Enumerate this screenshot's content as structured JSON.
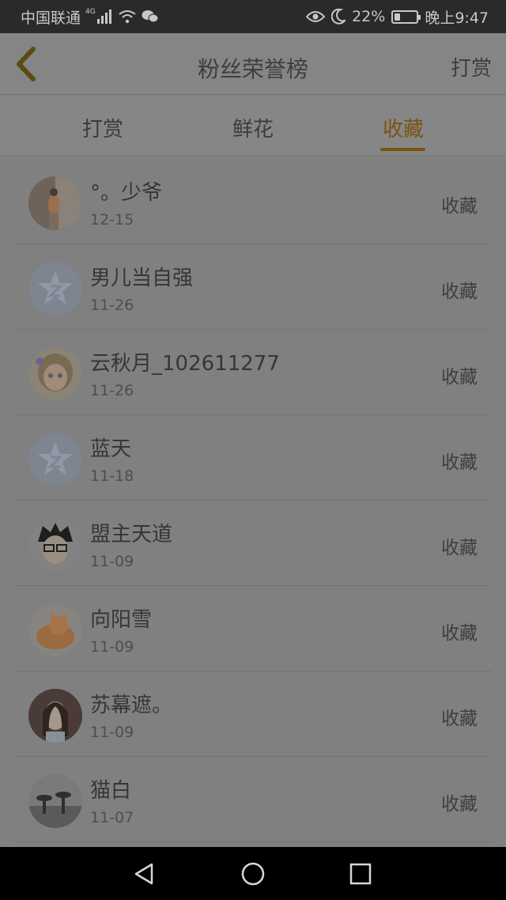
{
  "status_bar": {
    "carrier": "中国联通",
    "network": "4G",
    "battery": "22%",
    "battery_level": 0.22,
    "time": "晚上9:47",
    "icons": [
      "signal-icon",
      "wifi-icon",
      "wechat-icon",
      "eye-icon",
      "moon-icon",
      "battery-icon"
    ]
  },
  "header": {
    "back_icon": "chevron-left-icon",
    "title": "粉丝荣誉榜",
    "action": "打赏"
  },
  "tabs": {
    "items": [
      {
        "label": "打赏"
      },
      {
        "label": "鲜花"
      },
      {
        "label": "收藏"
      }
    ],
    "active_index": 2,
    "accent_color": "#7a5410"
  },
  "fans": [
    {
      "name": "°。少爷",
      "date": "12-15",
      "type": "收藏",
      "avatar": "photo-avatar"
    },
    {
      "name": "男儿当自强",
      "date": "11-26",
      "type": "收藏",
      "avatar": "qq-default-avatar"
    },
    {
      "name": "云秋月_102611277",
      "date": "11-26",
      "type": "收藏",
      "avatar": "anime-girl-avatar"
    },
    {
      "name": "蓝天",
      "date": "11-18",
      "type": "收藏",
      "avatar": "qq-default-avatar"
    },
    {
      "name": "盟主天道",
      "date": "11-09",
      "type": "收藏",
      "avatar": "anime-boy-avatar"
    },
    {
      "name": "向阳雪",
      "date": "11-09",
      "type": "收藏",
      "avatar": "cat-avatar"
    },
    {
      "name": "苏幕遮。",
      "date": "11-09",
      "type": "收藏",
      "avatar": "girl-photo-avatar"
    },
    {
      "name": "猫白",
      "date": "11-07",
      "type": "收藏",
      "avatar": "street-photo-avatar"
    }
  ],
  "nav_bar": {
    "buttons": [
      "back-triangle-icon",
      "home-circle-icon",
      "recents-square-icon"
    ]
  }
}
